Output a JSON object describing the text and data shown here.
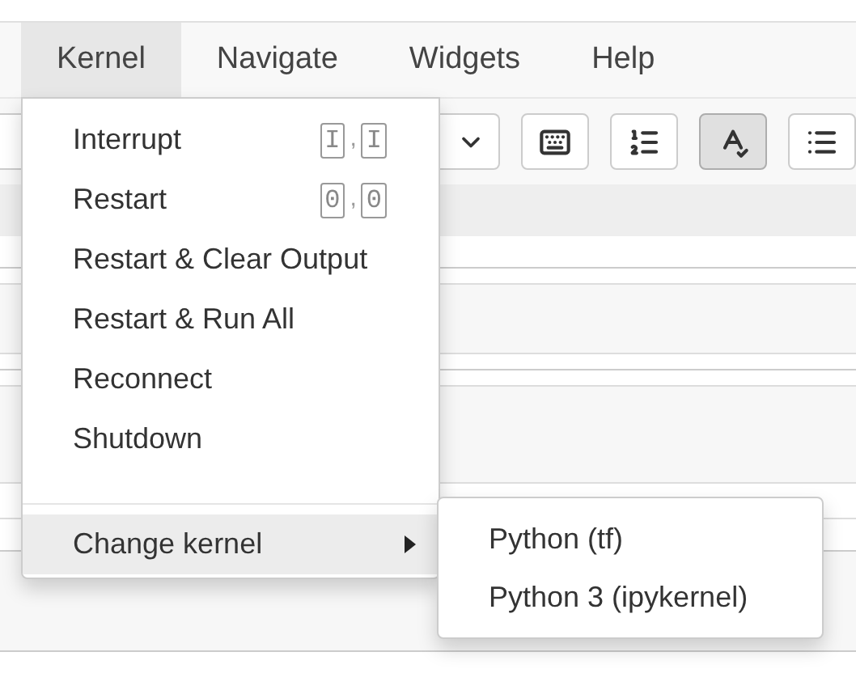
{
  "menubar": [
    {
      "label": "Kernel",
      "selected": true
    },
    {
      "label": "Navigate",
      "selected": false
    },
    {
      "label": "Widgets",
      "selected": false
    },
    {
      "label": "Help",
      "selected": false
    }
  ],
  "toolbar": {
    "buttons": [
      {
        "kind": "keyboard",
        "pressed": false
      },
      {
        "kind": "numbered-list",
        "pressed": false
      },
      {
        "kind": "spellcheck",
        "pressed": true
      },
      {
        "kind": "list",
        "pressed": false
      }
    ]
  },
  "kernel_menu": {
    "items": [
      {
        "kind": "item",
        "label": "Interrupt",
        "shortcut": [
          "I",
          ",",
          "I"
        ],
        "highlighted": false
      },
      {
        "kind": "item",
        "label": "Restart",
        "shortcut": [
          "0",
          ",",
          "0"
        ],
        "highlighted": false
      },
      {
        "kind": "item",
        "label": "Restart & Clear Output",
        "highlighted": false
      },
      {
        "kind": "item",
        "label": "Restart & Run All",
        "highlighted": false
      },
      {
        "kind": "item",
        "label": "Reconnect",
        "highlighted": false
      },
      {
        "kind": "item",
        "label": "Shutdown",
        "highlighted": false
      },
      {
        "kind": "divider"
      },
      {
        "kind": "submenu",
        "label": "Change kernel",
        "highlighted": true
      }
    ]
  },
  "change_kernel_submenu": {
    "items": [
      {
        "label": "Python (tf)"
      },
      {
        "label": "Python 3 (ipykernel)"
      }
    ]
  }
}
